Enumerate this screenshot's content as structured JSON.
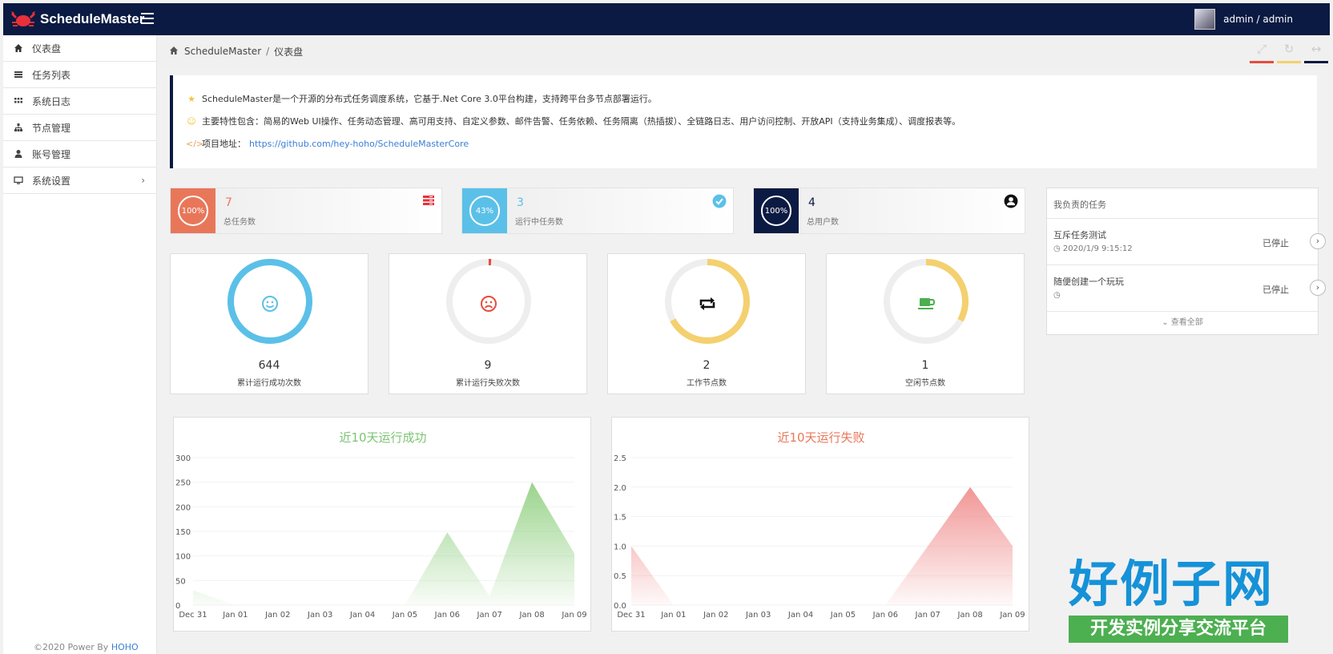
{
  "app": {
    "title": "ScheduleMaster",
    "user": "admin / admin"
  },
  "sidebar": {
    "items": [
      {
        "label": "仪表盘",
        "icon": "home-icon"
      },
      {
        "label": "任务列表",
        "icon": "list-icon"
      },
      {
        "label": "系统日志",
        "icon": "grid-icon"
      },
      {
        "label": "节点管理",
        "icon": "sitemap-icon"
      },
      {
        "label": "账号管理",
        "icon": "user-icon"
      },
      {
        "label": "系统设置",
        "icon": "monitor-icon"
      }
    ],
    "footer_prefix": "©2020 Power By ",
    "footer_link": "HOHO"
  },
  "breadcrumb": {
    "root": "ScheduleMaster",
    "sep": "/",
    "current": "仪表盘"
  },
  "toolbar": {
    "accent_colors": [
      "#e74c3c",
      "#f4d06f",
      "#0b1a42"
    ]
  },
  "intro": {
    "line1": "ScheduleMaster是一个开源的分布式任务调度系统，它基于.Net Core 3.0平台构建，支持跨平台多节点部署运行。",
    "line2": "主要特性包含：简易的Web UI操作、任务动态管理、高可用支持、自定义参数、邮件告警、任务依赖、任务隔离（热插拔）、全链路日志、用户访问控制、开放API（支持业务集成）、调度报表等。",
    "line3_label": "项目地址：",
    "line3_link": "https://github.com/hey-hoho/ScheduleMasterCore"
  },
  "stats": [
    {
      "pct": "100%",
      "value": "7",
      "label": "总任务数",
      "color": "#e8775a",
      "icon": "tasks-icon"
    },
    {
      "pct": "43%",
      "value": "3",
      "label": "运行中任务数",
      "color": "#5bc0e8",
      "icon": "check-circle-icon"
    },
    {
      "pct": "100%",
      "value": "4",
      "label": "总用户数",
      "color": "#0b1a42",
      "icon": "user-circle-icon"
    }
  ],
  "gauges": [
    {
      "value": "644",
      "label": "累计运行成功次数",
      "fraction": 1.0,
      "color": "#5bc0e8",
      "icon": "smile-icon"
    },
    {
      "value": "9",
      "label": "累计运行失败次数",
      "fraction": 0.01,
      "color": "#e74c3c",
      "icon": "frown-icon"
    },
    {
      "value": "2",
      "label": "工作节点数",
      "fraction": 0.67,
      "color": "#f4d06f",
      "icon": "retweet-icon"
    },
    {
      "value": "1",
      "label": "空闲节点数",
      "fraction": 0.33,
      "color": "#f4d06f",
      "icon": "coffee-icon"
    }
  ],
  "tasks": {
    "title": "我负责的任务",
    "items": [
      {
        "name": "互斥任务测试",
        "time": "2020/1/9 9:15:12",
        "status": "已停止"
      },
      {
        "name": "随便创建一个玩玩",
        "time": "",
        "status": "已停止"
      }
    ],
    "view_all": "查看全部"
  },
  "chart_data": [
    {
      "type": "area",
      "title": "近10天运行成功",
      "title_color": "#7cc472",
      "x": [
        "Dec 31",
        "Jan 01",
        "Jan 02",
        "Jan 03",
        "Jan 04",
        "Jan 05",
        "Jan 06",
        "Jan 07",
        "Jan 08",
        "Jan 09"
      ],
      "values": [
        30,
        0,
        0,
        0,
        0,
        0,
        148,
        18,
        250,
        105
      ],
      "ylim": [
        0,
        300
      ],
      "yticks": [
        "0",
        "50",
        "100",
        "150",
        "200",
        "250",
        "300"
      ],
      "color": "#8fcf7f"
    },
    {
      "type": "area",
      "title": "近10天运行失败",
      "title_color": "#e8775a",
      "x": [
        "Dec 31",
        "Jan 01",
        "Jan 02",
        "Jan 03",
        "Jan 04",
        "Jan 05",
        "Jan 06",
        "Jan 07",
        "Jan 08",
        "Jan 09"
      ],
      "values": [
        1.0,
        0,
        0,
        0,
        0,
        0,
        0,
        1.0,
        2.0,
        1.0
      ],
      "ylim": [
        0,
        2.5
      ],
      "yticks": [
        "0.0",
        "0.5",
        "1.0",
        "1.5",
        "2.0",
        "2.5"
      ],
      "color": "#f08a8a"
    }
  ],
  "brand": {
    "title": "好例子网",
    "subtitle": "开发实例分享交流平台"
  }
}
